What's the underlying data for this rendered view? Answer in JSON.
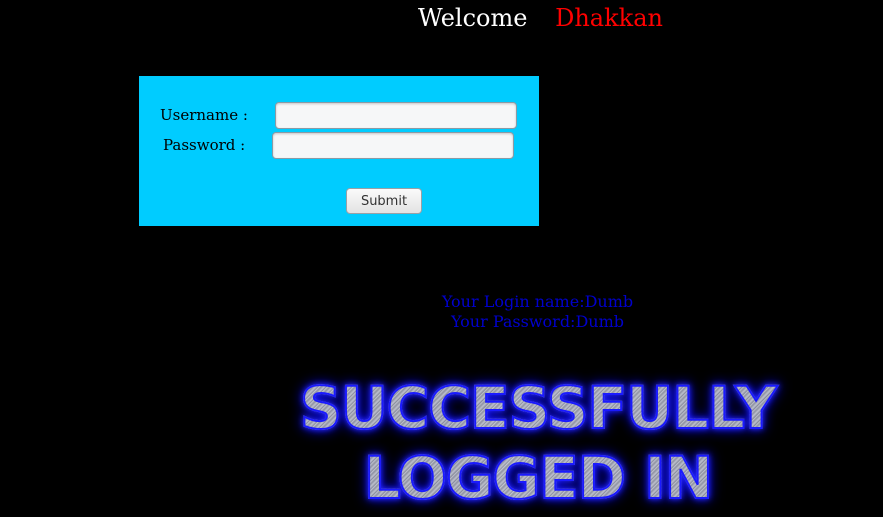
{
  "header": {
    "welcome_word": "Welcome",
    "user_name": "Dhakkan"
  },
  "login_form": {
    "username_label": "Username :",
    "password_label": "Password :",
    "username_value": "",
    "password_value": "",
    "submit_label": "Submit"
  },
  "result": {
    "login_name_line": "Your Login name:Dumb",
    "password_line": "Your Password:Dumb"
  },
  "banner": {
    "line1": "SUCCESSFULLY",
    "line2": "LOGGED IN"
  },
  "colors": {
    "background": "#000000",
    "panel": "#00ccff",
    "welcome_text": "#ffffff",
    "user_name_text": "#ff0000",
    "result_text": "#0000cc",
    "banner_glow": "#1a1aff"
  }
}
